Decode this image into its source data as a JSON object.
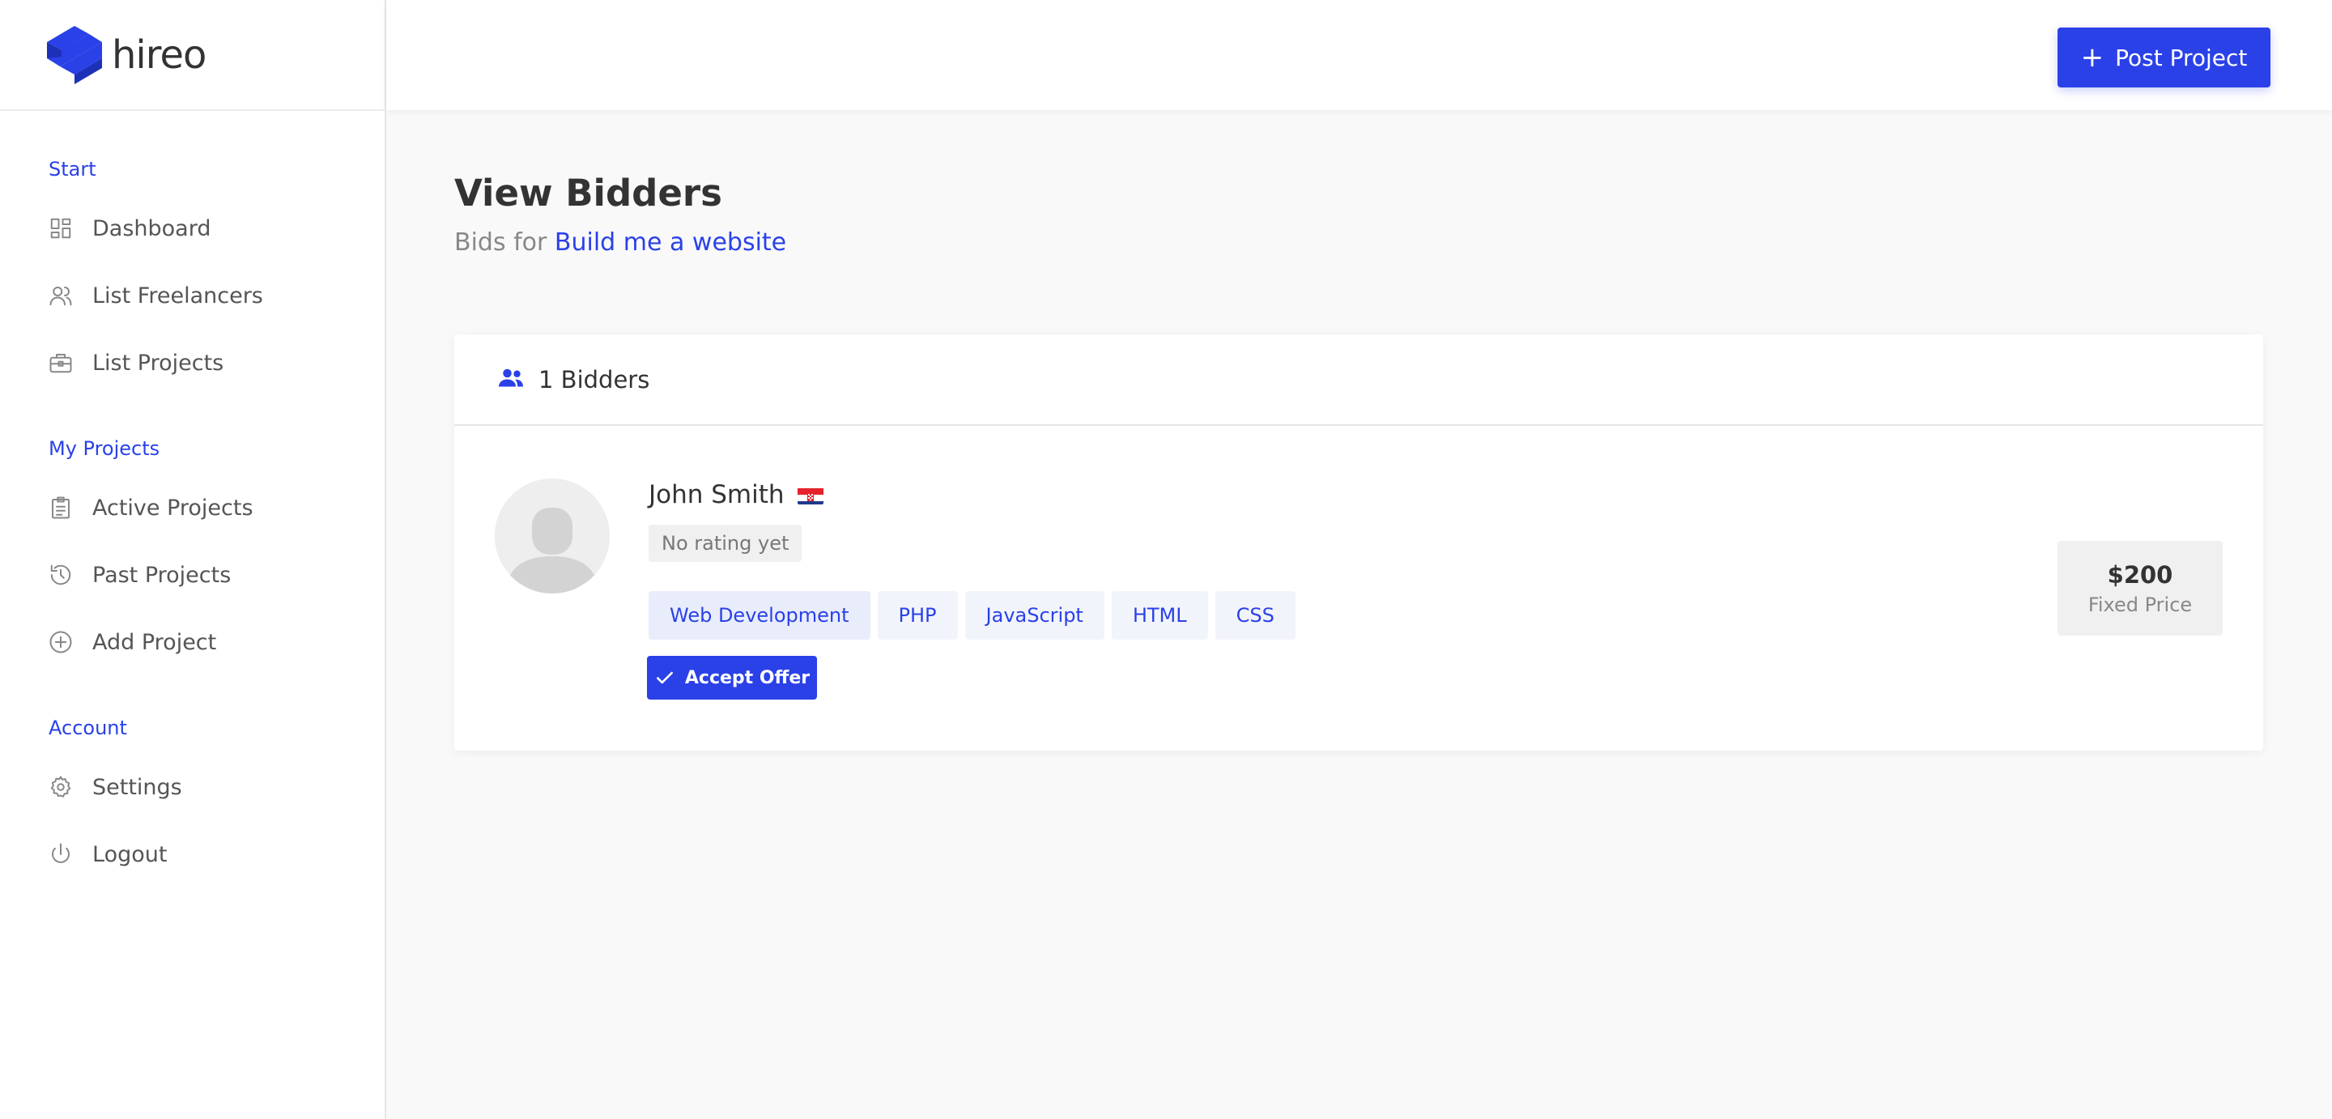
{
  "brand": {
    "name": "hireo",
    "color": "#2a41e8"
  },
  "sidebar": {
    "sections": [
      {
        "heading": "Start",
        "items": [
          {
            "label": "Dashboard",
            "icon": "dashboard-icon"
          },
          {
            "label": "List Freelancers",
            "icon": "users-icon"
          },
          {
            "label": "List Projects",
            "icon": "briefcase-icon"
          }
        ]
      },
      {
        "heading": "My Projects",
        "items": [
          {
            "label": "Active Projects",
            "icon": "clipboard-icon"
          },
          {
            "label": "Past Projects",
            "icon": "history-icon"
          },
          {
            "label": "Add Project",
            "icon": "plus-circle-icon"
          }
        ]
      },
      {
        "heading": "Account",
        "items": [
          {
            "label": "Settings",
            "icon": "gear-icon"
          },
          {
            "label": "Logout",
            "icon": "power-icon"
          }
        ]
      }
    ]
  },
  "header": {
    "post_button": "Post Project",
    "post_icon": "plus-icon"
  },
  "page": {
    "title": "View Bidders",
    "subtitle_prefix": "Bids for",
    "project_link": "Build me a website"
  },
  "bidders": {
    "count_label": "1 Bidders",
    "items": [
      {
        "name": "John Smith",
        "flag": "croatia-flag",
        "rating": "No rating yet",
        "skills": [
          "Web Development",
          "PHP",
          "JavaScript",
          "HTML",
          "CSS"
        ],
        "accept_label": "Accept Offer",
        "price": "$200",
        "price_type": "Fixed Price"
      }
    ]
  }
}
